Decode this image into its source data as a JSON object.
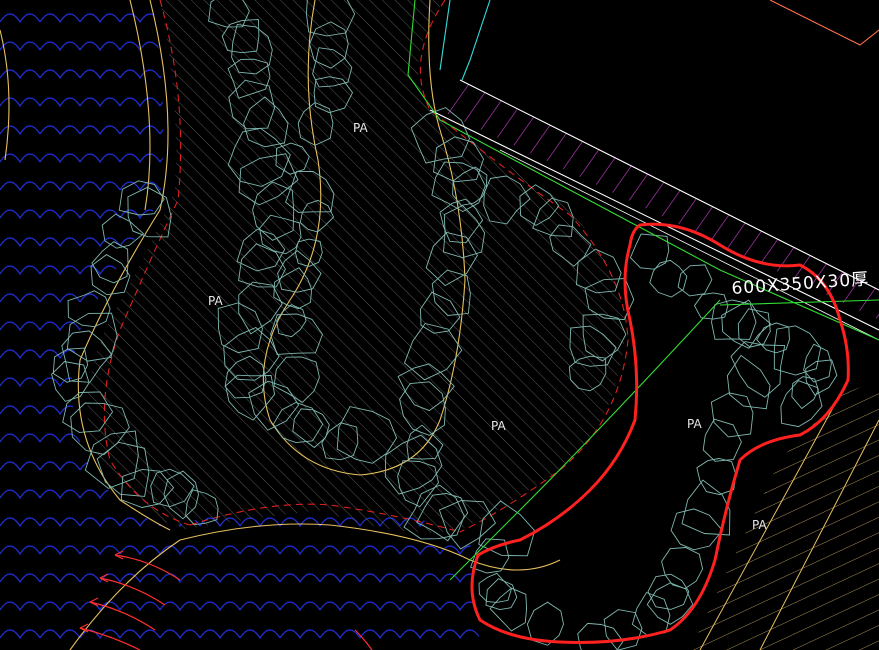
{
  "drawing": {
    "background": "#000000",
    "colors": {
      "water_waves": "#1f2ed8",
      "hatch": "#7a7a7a",
      "shrub_outline": "#7fb8b0",
      "boundary_yellow": "#e8c060",
      "boundary_red_dashed": "#e02020",
      "revision_cloud": "#ff2020",
      "edge_green": "#33dd33",
      "magenta_hatch": "#d040d0",
      "white_edge": "#ffffff",
      "cyan_line": "#33dddd",
      "flow_arrows": "#ff3030",
      "orange_line": "#ff7050"
    },
    "labels": {
      "pa_1": "PA",
      "pa_2": "PA",
      "pa_3": "PA",
      "pa_4": "PA",
      "pa_5": "PA"
    },
    "dimension_text": "600X350X30厚"
  }
}
